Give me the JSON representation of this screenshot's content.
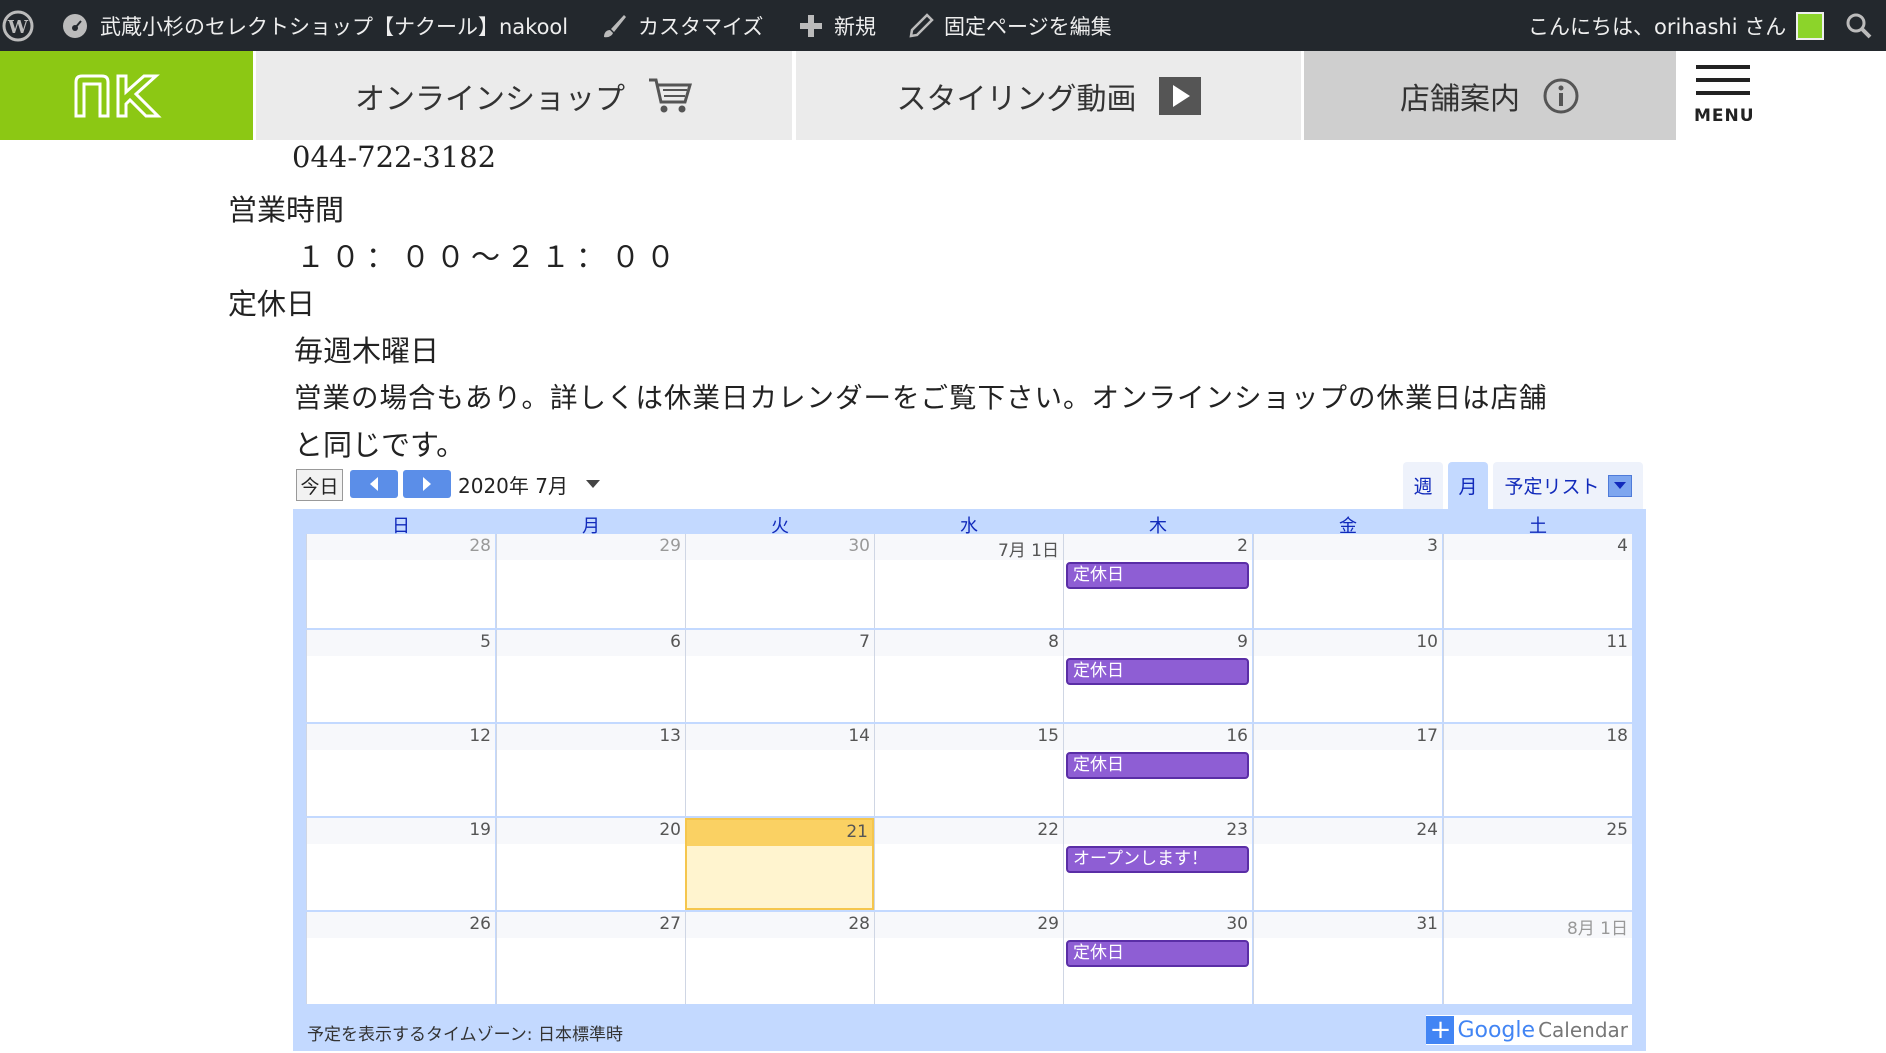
{
  "admin_bar": {
    "site_name": "武蔵小杉のセレクトショップ【ナクール】nakool",
    "customize": "カスタマイズ",
    "new": "新規",
    "edit_page": "固定ページを編集",
    "greeting": "こんにちは、orihashi さん"
  },
  "nav": {
    "logo_text": "nk",
    "tabs": [
      {
        "label": "オンラインショップ",
        "icon": "cart-icon"
      },
      {
        "label": "スタイリング動画",
        "icon": "play-icon"
      },
      {
        "label": "店舗案内",
        "icon": "info-icon"
      }
    ],
    "menu_label": "MENU"
  },
  "info": {
    "phone": "044-722-3182",
    "hours_label": "営業時間",
    "hours_value": "１０：００～２１：００",
    "closed_label": "定休日",
    "closed_value": "毎週木曜日",
    "note_line1": "営業の場合もあり。詳しくは休業日カレンダーをご覧下さい。オンラインショップの休業日は店舗",
    "note_line2": "と同じです。"
  },
  "calendar": {
    "today_button": "今日",
    "month_label": "2020年 7月",
    "view_week": "週",
    "view_month": "月",
    "view_agenda": "予定リスト",
    "weekdays": [
      "日",
      "月",
      "火",
      "水",
      "木",
      "金",
      "土"
    ],
    "weeks": [
      [
        "28",
        "29",
        "30",
        "7月 1日",
        "2",
        "3",
        "4"
      ],
      [
        "5",
        "6",
        "7",
        "8",
        "9",
        "10",
        "11"
      ],
      [
        "12",
        "13",
        "14",
        "15",
        "16",
        "17",
        "18"
      ],
      [
        "19",
        "20",
        "21",
        "22",
        "23",
        "24",
        "25"
      ],
      [
        "26",
        "27",
        "28",
        "29",
        "30",
        "31",
        "8月 1日"
      ]
    ],
    "events": [
      {
        "week": 0,
        "day": 4,
        "title": "定休日"
      },
      {
        "week": 1,
        "day": 4,
        "title": "定休日"
      },
      {
        "week": 2,
        "day": 4,
        "title": "定休日"
      },
      {
        "week": 3,
        "day": 4,
        "title": "オープンします！"
      },
      {
        "week": 4,
        "day": 4,
        "title": "定休日"
      }
    ],
    "today": {
      "week": 3,
      "day": 2
    },
    "timezone_note": "予定を表示するタイムゾーン: 日本標準時",
    "google_label": "Google",
    "calendar_label": "Calendar",
    "colors": {
      "event": "#8e5ed4",
      "today": "#fad163",
      "header": "#c3d9ff"
    }
  }
}
